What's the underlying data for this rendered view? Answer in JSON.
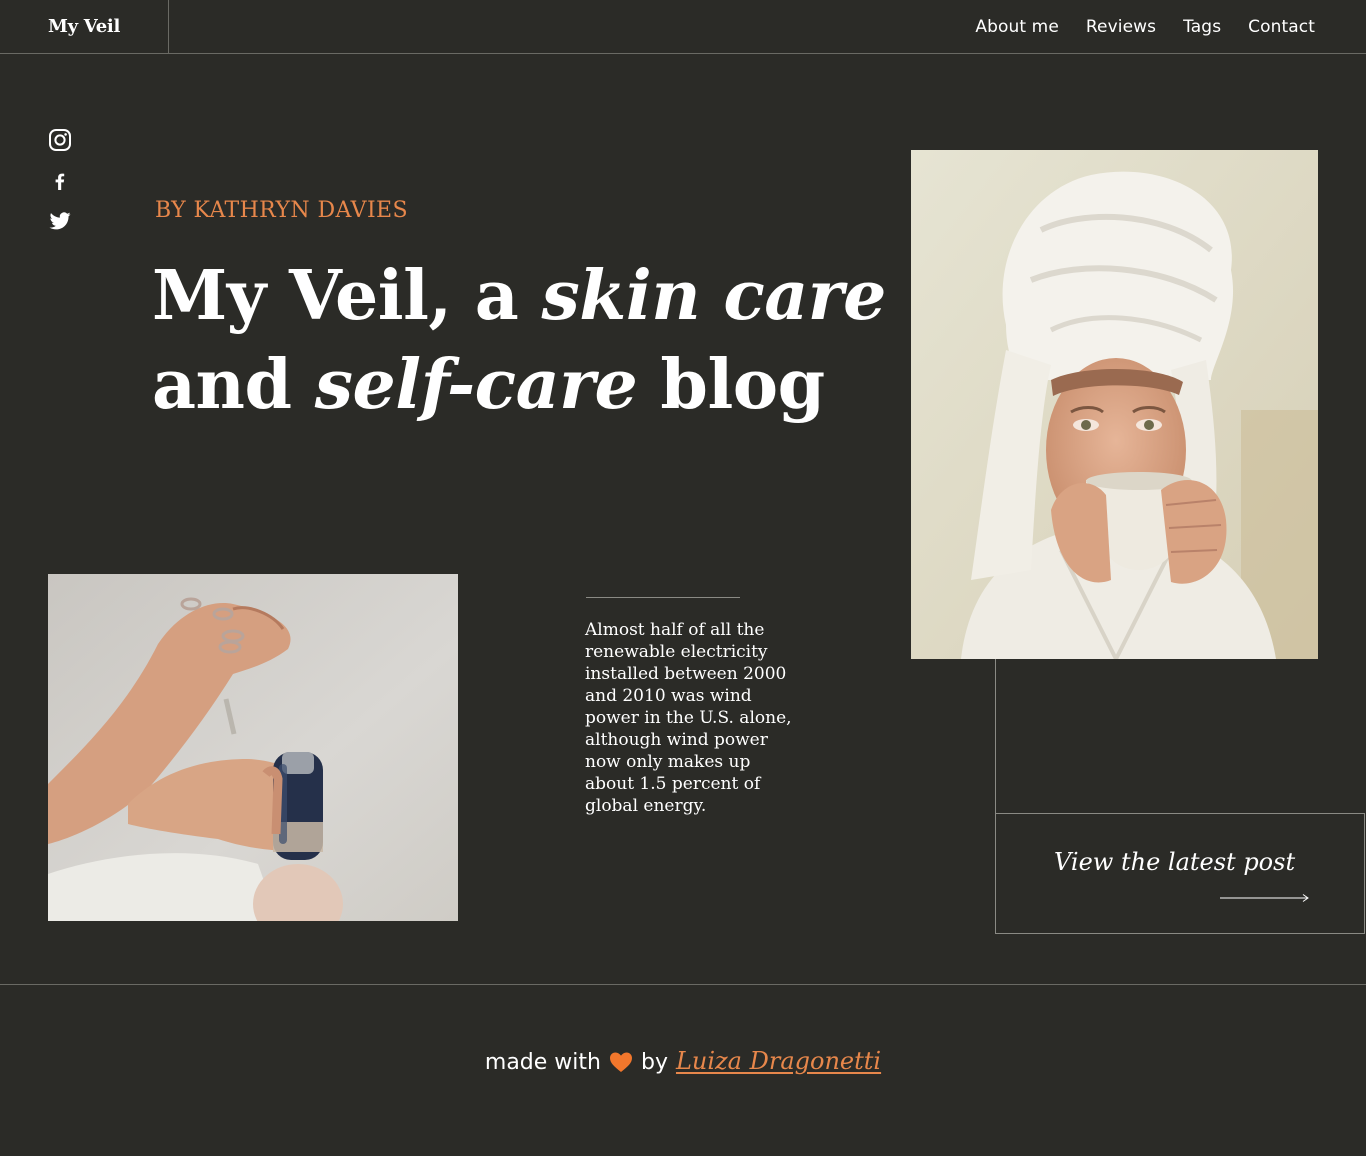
{
  "header": {
    "brand": "My Veil",
    "nav": [
      {
        "label": "About me"
      },
      {
        "label": "Reviews"
      },
      {
        "label": "Tags"
      },
      {
        "label": "Contact"
      }
    ]
  },
  "social": [
    {
      "icon": "instagram-icon"
    },
    {
      "icon": "facebook-icon"
    },
    {
      "icon": "twitter-icon"
    }
  ],
  "hero": {
    "byline": "BY KATHRYN DAVIES",
    "headline": {
      "part1": "My Veil, a ",
      "italic1": "skin care",
      "part2": "and ",
      "italic2": "self-care",
      "part3": " blog"
    }
  },
  "images": {
    "towel": "woman-in-towel-sipping-drink",
    "hands": "hands-holding-serum-bottle"
  },
  "excerpt": {
    "text": "Almost half of all the renewable electricity installed between 2000 and 2010 was wind power in the U.S. alone, although wind power now only makes up about 1.5 percent of global energy."
  },
  "latest": {
    "label": "View the latest post"
  },
  "footer": {
    "made_with": "made with",
    "by": "by",
    "author": "Luiza Dragonetti"
  },
  "colors": {
    "background": "#2b2b27",
    "accent": "#e7874b",
    "heart": "#f2772c",
    "text": "#ffffff"
  }
}
